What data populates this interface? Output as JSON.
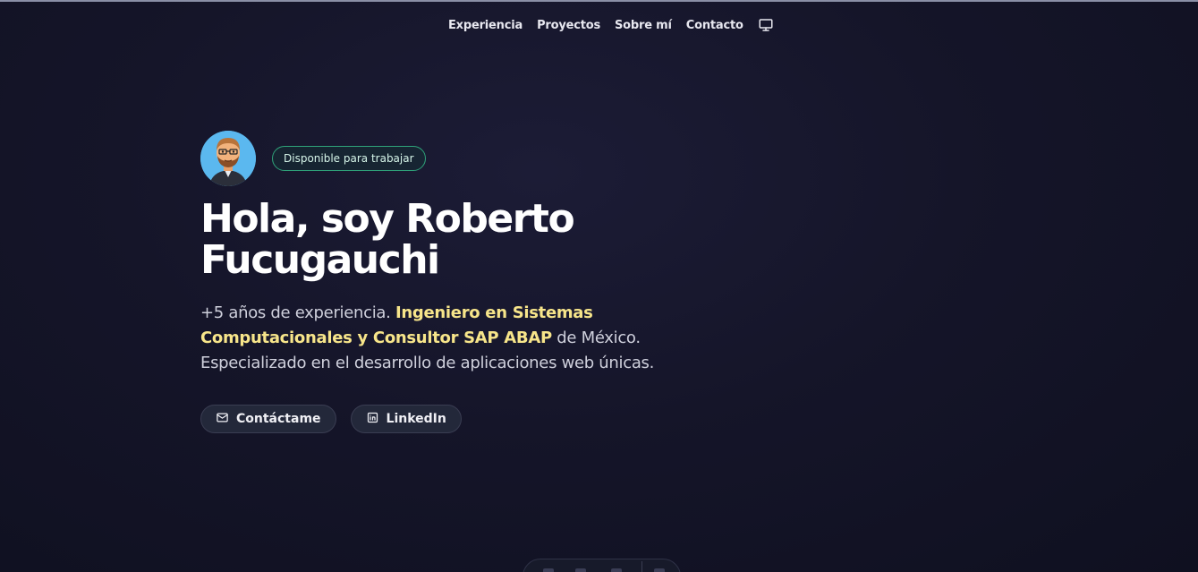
{
  "nav": {
    "items": [
      {
        "label": "Experiencia"
      },
      {
        "label": "Proyectos"
      },
      {
        "label": "Sobre mí"
      },
      {
        "label": "Contacto"
      }
    ],
    "theme_icon": "monitor-icon"
  },
  "hero": {
    "avatar": "avatar",
    "status_badge": "Disponible para trabajar",
    "title": "Hola, soy Roberto Fucugauchi",
    "intro_prefix": "+5 años de experiencia. ",
    "intro_highlight": "Ingeniero en Sistemas Computacionales y Consultor SAP ABAP",
    "intro_suffix": " de México. Especializado en el desarrollo de aplicaciones web únicas.",
    "buttons": {
      "contact_label": "Contáctame",
      "contact_icon": "mail-icon",
      "linkedin_label": "LinkedIn",
      "linkedin_icon": "linkedin-icon"
    }
  },
  "colors": {
    "background": "#0f1020",
    "highlight": "#f7e58a",
    "badge_border": "#2fa37a"
  }
}
